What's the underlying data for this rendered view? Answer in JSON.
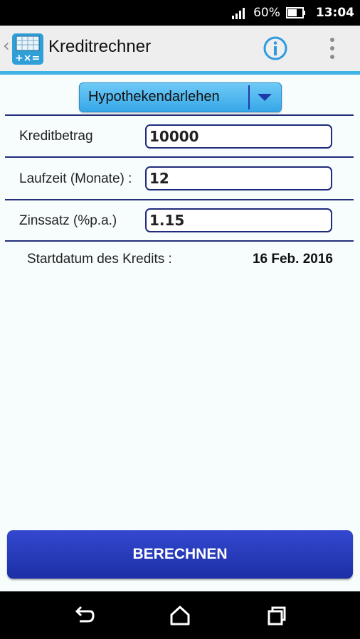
{
  "status_bar": {
    "battery": "60%",
    "time": "13:04"
  },
  "app_bar": {
    "back_glyph": "‹",
    "title": "Kreditrechner",
    "app_icon": "calculator-icon",
    "info_icon": "info-icon",
    "overflow_icon": "more-vert-icon"
  },
  "loan_type": {
    "selected": "Hypothekendarlehen"
  },
  "form": {
    "amount_label": "Kreditbetrag",
    "amount_value": "10000",
    "term_label": "Laufzeit (Monate) :",
    "term_value": "12",
    "rate_label": "Zinssatz (%p.a.)",
    "rate_value": "1.15"
  },
  "start_date": {
    "label": "Startdatum des Kredits :",
    "value": "16 Feb. 2016"
  },
  "calculate_button": {
    "label": "BERECHNEN"
  },
  "colors": {
    "accent": "#3fb3e6",
    "button": "#2438b8",
    "border": "#1e2a7c"
  }
}
